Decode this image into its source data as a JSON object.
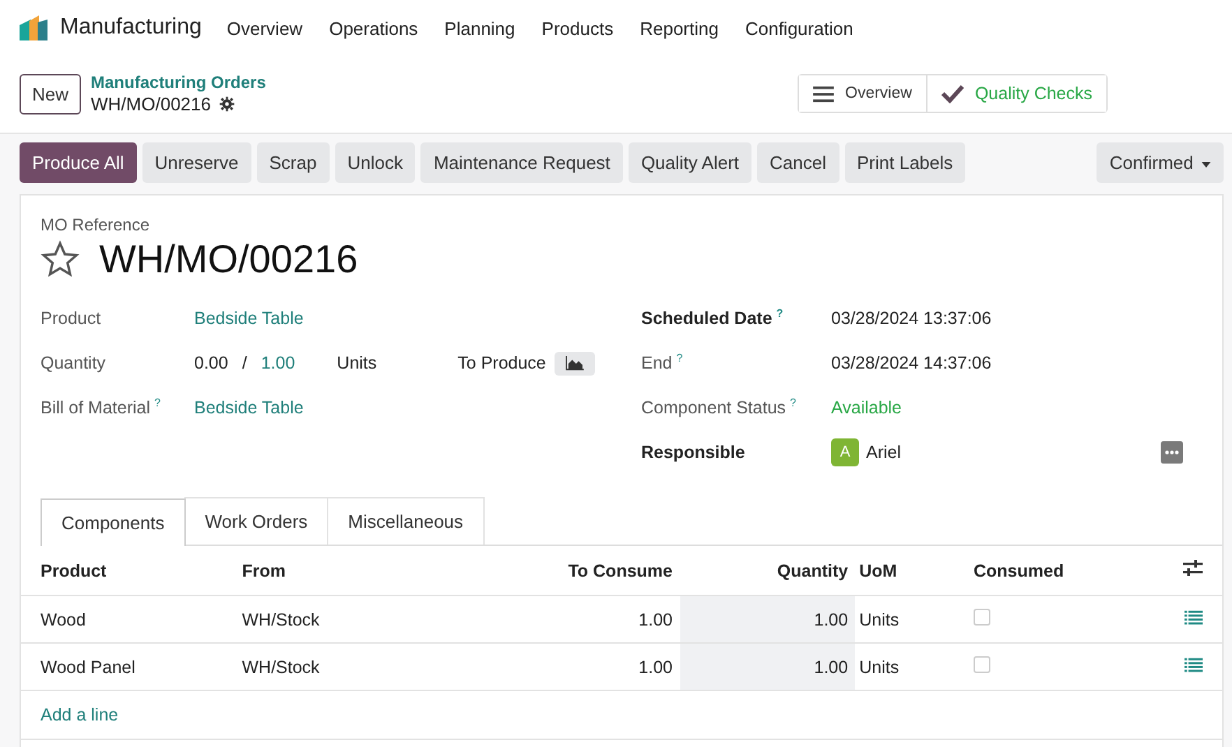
{
  "app": {
    "name": "Manufacturing"
  },
  "menu": [
    "Overview",
    "Operations",
    "Planning",
    "Products",
    "Reporting",
    "Configuration"
  ],
  "control": {
    "new_button": "New",
    "breadcrumb": "Manufacturing Orders",
    "record": "WH/MO/00216"
  },
  "smart_buttons": [
    {
      "kind": "overview",
      "label": "Overview"
    },
    {
      "kind": "quality",
      "label": "Quality Checks"
    }
  ],
  "actions": [
    {
      "label": "Produce All",
      "primary": true
    },
    {
      "label": "Unreserve",
      "primary": false
    },
    {
      "label": "Scrap",
      "primary": false
    },
    {
      "label": "Unlock",
      "primary": false
    },
    {
      "label": "Maintenance Request",
      "primary": false
    },
    {
      "label": "Quality Alert",
      "primary": false
    },
    {
      "label": "Cancel",
      "primary": false
    },
    {
      "label": "Print Labels",
      "primary": false
    }
  ],
  "status": "Confirmed",
  "form": {
    "ref_label": "MO Reference",
    "reference": "WH/MO/00216",
    "starred": false,
    "product": {
      "label": "Product",
      "value": "Bedside Table"
    },
    "quantity": {
      "label": "Quantity",
      "produced": "0.00",
      "separator": "/",
      "planned": "1.00",
      "uom": "Units",
      "to_produce": "To Produce"
    },
    "bom": {
      "label": "Bill of Material",
      "help": "?",
      "value": "Bedside Table"
    },
    "right": [
      {
        "kind": "text",
        "label": "Scheduled Date",
        "help": "?",
        "strong": true,
        "value": "03/28/2024 13:37:06"
      },
      {
        "kind": "text",
        "label": "End",
        "help": "?",
        "strong": false,
        "value": "03/28/2024 14:37:06"
      },
      {
        "kind": "status",
        "label": "Component Status",
        "help": "?",
        "strong": false,
        "value": "Available"
      },
      {
        "kind": "user",
        "label": "Responsible",
        "strong": true,
        "initial": "A",
        "color": "#7fb534",
        "value": "Ariel"
      }
    ]
  },
  "tabs": [
    {
      "label": "Components",
      "selected": true
    },
    {
      "label": "Work Orders",
      "selected": false
    },
    {
      "label": "Miscellaneous",
      "selected": false
    }
  ],
  "table": {
    "columns": [
      "Product",
      "From",
      "To Consume",
      "Quantity",
      "UoM",
      "Consumed"
    ],
    "rows": [
      {
        "product": "Wood",
        "from": "WH/Stock",
        "to_consume": "1.00",
        "quantity": "1.00",
        "uom": "Units",
        "consumed": false
      },
      {
        "product": "Wood Panel",
        "from": "WH/Stock",
        "to_consume": "1.00",
        "quantity": "1.00",
        "uom": "Units",
        "consumed": false
      }
    ],
    "add_line": "Add a line"
  }
}
